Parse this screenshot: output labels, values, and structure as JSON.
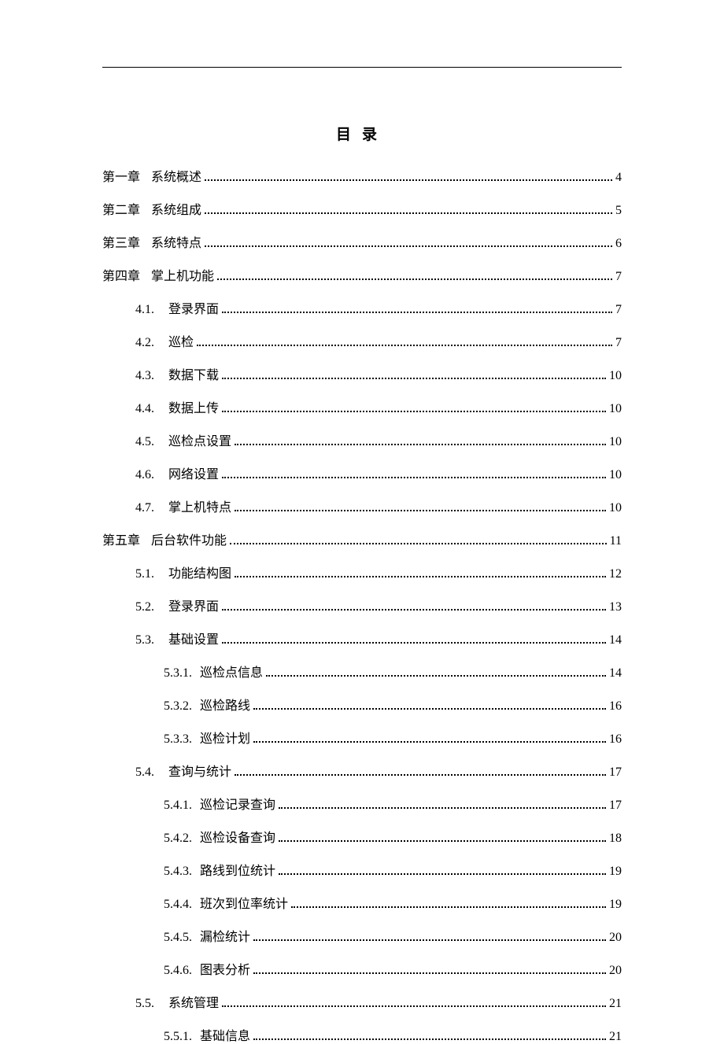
{
  "title": "目录",
  "entries": [
    {
      "indent": 0,
      "gap": "wide",
      "label": "第一章",
      "text": "系统概述",
      "page": "4"
    },
    {
      "indent": 0,
      "gap": "wide",
      "label": "第二章",
      "text": "系统组成",
      "page": "5"
    },
    {
      "indent": 0,
      "gap": "wide",
      "label": "第三章",
      "text": "系统特点",
      "page": "6"
    },
    {
      "indent": 0,
      "gap": "wide",
      "label": "第四章",
      "text": "掌上机功能",
      "page": "7"
    },
    {
      "indent": 1,
      "gap": "mid",
      "label": "4.1.",
      "text": "登录界面",
      "page": "7"
    },
    {
      "indent": 1,
      "gap": "mid",
      "label": "4.2.",
      "text": "巡检",
      "page": "7"
    },
    {
      "indent": 1,
      "gap": "mid",
      "label": "4.3.",
      "text": "数据下载",
      "page": "10"
    },
    {
      "indent": 1,
      "gap": "mid",
      "label": "4.4.",
      "text": "数据上传",
      "page": "10"
    },
    {
      "indent": 1,
      "gap": "mid",
      "label": "4.5.",
      "text": "巡检点设置",
      "page": "10"
    },
    {
      "indent": 1,
      "gap": "mid",
      "label": "4.6.",
      "text": "网络设置",
      "page": "10"
    },
    {
      "indent": 1,
      "gap": "mid",
      "label": "4.7.",
      "text": "掌上机特点",
      "page": "10"
    },
    {
      "indent": 0,
      "gap": "wide",
      "label": "第五章",
      "text": "后台软件功能",
      "page": "11"
    },
    {
      "indent": 1,
      "gap": "mid",
      "label": "5.1.",
      "text": "功能结构图",
      "page": "12"
    },
    {
      "indent": 1,
      "gap": "mid",
      "label": "5.2.",
      "text": "登录界面",
      "page": "13"
    },
    {
      "indent": 1,
      "gap": "mid",
      "label": "5.3.",
      "text": "基础设置",
      "page": "14"
    },
    {
      "indent": 2,
      "gap": "narrow",
      "label": "5.3.1.",
      "text": "巡检点信息",
      "page": "14"
    },
    {
      "indent": 2,
      "gap": "narrow",
      "label": "5.3.2.",
      "text": "巡检路线",
      "page": "16"
    },
    {
      "indent": 2,
      "gap": "narrow",
      "label": "5.3.3.",
      "text": "巡检计划",
      "page": "16"
    },
    {
      "indent": 1,
      "gap": "mid",
      "label": "5.4.",
      "text": "查询与统计",
      "page": "17"
    },
    {
      "indent": 2,
      "gap": "narrow",
      "label": "5.4.1.",
      "text": "巡检记录查询",
      "page": "17"
    },
    {
      "indent": 2,
      "gap": "narrow",
      "label": "5.4.2.",
      "text": "巡检设备查询",
      "page": "18"
    },
    {
      "indent": 2,
      "gap": "narrow",
      "label": "5.4.3.",
      "text": "路线到位统计",
      "page": "19"
    },
    {
      "indent": 2,
      "gap": "narrow",
      "label": "5.4.4.",
      "text": "班次到位率统计",
      "page": "19"
    },
    {
      "indent": 2,
      "gap": "narrow",
      "label": "5.4.5.",
      "text": "漏检统计",
      "page": "20"
    },
    {
      "indent": 2,
      "gap": "narrow",
      "label": "5.4.6.",
      "text": "图表分析",
      "page": "20"
    },
    {
      "indent": 1,
      "gap": "mid",
      "label": "5.5.",
      "text": "系统管理",
      "page": "21"
    },
    {
      "indent": 2,
      "gap": "narrow",
      "label": "5.5.1.",
      "text": "基础信息",
      "page": "21"
    }
  ]
}
